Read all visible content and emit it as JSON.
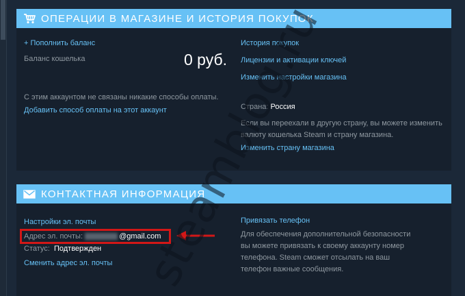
{
  "store_section": {
    "title": "Операции в магазине и история покупок",
    "add_funds_link": "+ Пополнить баланс",
    "wallet_label": "Баланс кошелька",
    "wallet_value": "0 руб.",
    "no_payment_text": "С этим аккаунтом не связаны никакие способы оплаты.",
    "add_payment_link": "Добавить способ оплаты на этот аккаунт",
    "purchase_history_link": "История покупок",
    "licenses_link": "Лицензии и активации ключей",
    "store_prefs_link": "Изменить настройки магазина",
    "country_label": "Страна:",
    "country_value": "Россия",
    "moved_text": "Если вы переехали в другую страну, вы можете изменить валюту кошелька Steam и страну магазина.",
    "change_country_link": "Изменить страну магазина"
  },
  "contact_section": {
    "title": "Контактная информация",
    "email_settings_link": "Настройки эл. почты",
    "email_label": "Адрес эл. почты:",
    "email_value": "@gmail.com",
    "status_label": "Статус:",
    "status_value": "Подтвержден",
    "change_email_link": "Сменить адрес эл. почты",
    "add_phone_link": "Привязать телефон",
    "phone_text": "Для обеспечения дополнительной безопасности вы можете привязать к своему аккаунту номер телефона. Steam сможет отсылать на ваш телефон важные сообщения."
  },
  "watermark": "steamblog.ru",
  "icons": {
    "store_section": "cart-icon",
    "contact_section": "envelope-icon",
    "annotation": "red-arrow-icon"
  },
  "colors": {
    "background": "#1b2838",
    "panel": "#16202d",
    "header": "#67c1f5",
    "link": "#67c1f5",
    "text": "#8f98a0",
    "annotation": "#d21717"
  }
}
